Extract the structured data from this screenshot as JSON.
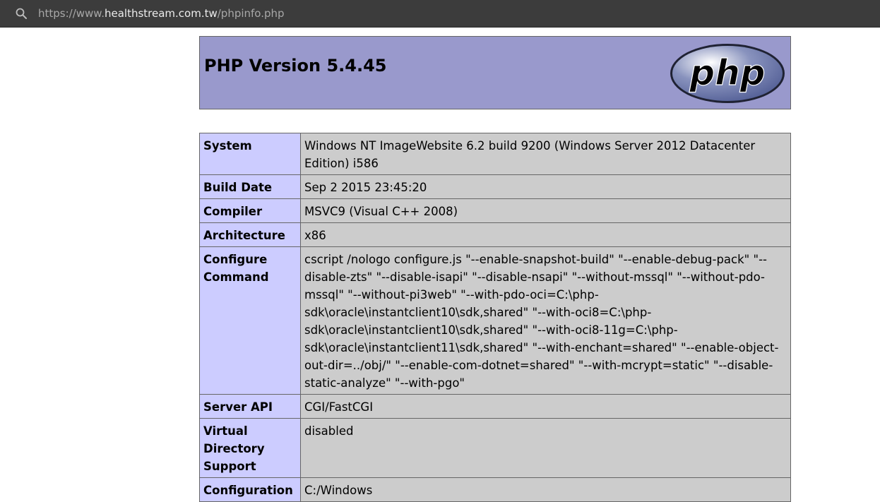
{
  "browser": {
    "url_prefix": "https://www.",
    "url_host": "healthstream.com.tw",
    "url_path": "/phpinfo.php"
  },
  "header": {
    "title": "PHP Version 5.4.45",
    "logo_text": "php"
  },
  "rows": [
    {
      "label": "System",
      "value": "Windows NT ImageWebsite 6.2 build 9200 (Windows Server 2012 Datacenter Edition) i586"
    },
    {
      "label": "Build Date",
      "value": "Sep 2 2015 23:45:20"
    },
    {
      "label": "Compiler",
      "value": "MSVC9 (Visual C++ 2008)"
    },
    {
      "label": "Architecture",
      "value": "x86"
    },
    {
      "label": "Configure Command",
      "value": "cscript /nologo configure.js \"--enable-snapshot-build\" \"--enable-debug-pack\" \"--disable-zts\" \"--disable-isapi\" \"--disable-nsapi\" \"--without-mssql\" \"--without-pdo-mssql\" \"--without-pi3web\" \"--with-pdo-oci=C:\\php-sdk\\oracle\\instantclient10\\sdk,shared\" \"--with-oci8=C:\\php-sdk\\oracle\\instantclient10\\sdk,shared\" \"--with-oci8-11g=C:\\php-sdk\\oracle\\instantclient11\\sdk,shared\" \"--with-enchant=shared\" \"--enable-object-out-dir=../obj/\" \"--enable-com-dotnet=shared\" \"--with-mcrypt=static\" \"--disable-static-analyze\" \"--with-pgo\""
    },
    {
      "label": "Server API",
      "value": "CGI/FastCGI"
    },
    {
      "label": "Virtual Directory Support",
      "value": "disabled"
    },
    {
      "label": "Configuration",
      "value": "C:/Windows"
    }
  ],
  "colors": {
    "header_bg": "#9999cc",
    "label_bg": "#ccccff",
    "value_bg": "#cccccc",
    "border": "#666666"
  }
}
